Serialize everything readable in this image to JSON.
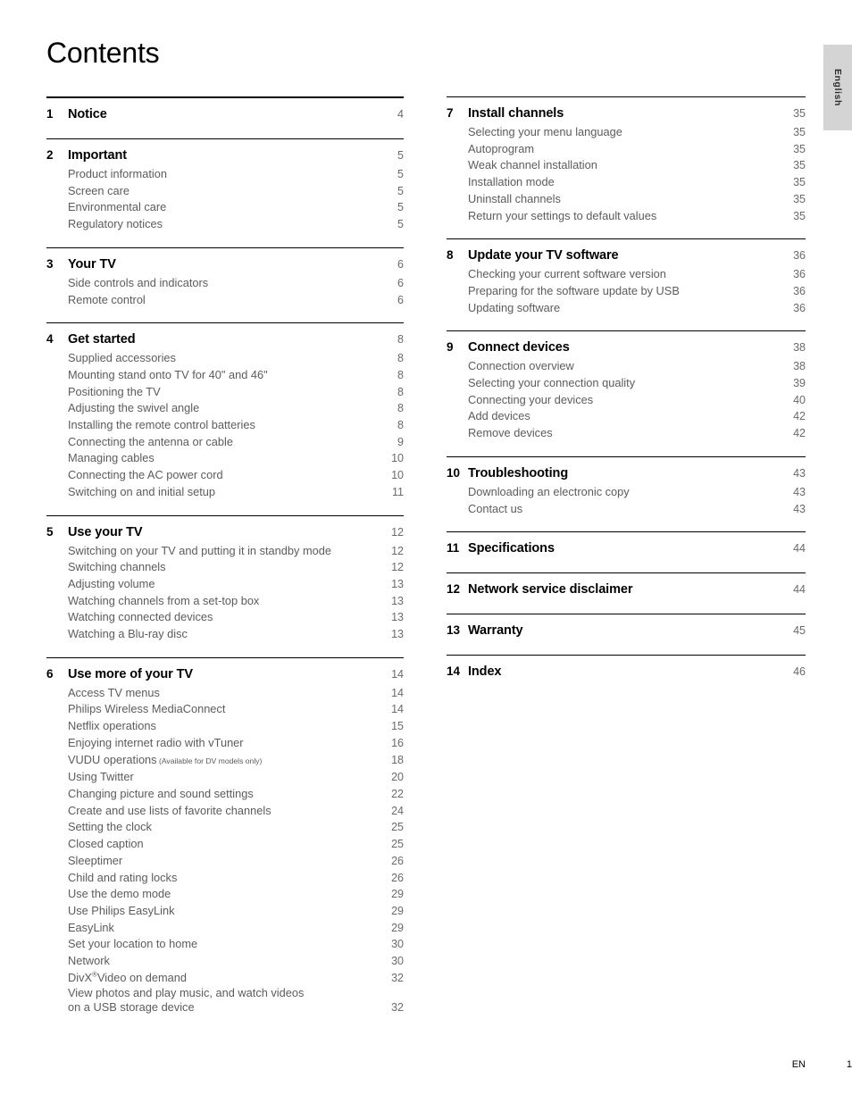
{
  "page_title": "Contents",
  "side_tab": {
    "label": "English"
  },
  "footer": {
    "locale": "EN",
    "page_number": "1"
  },
  "columns": {
    "left": [
      {
        "rule": "thick",
        "number": "1",
        "title": "Notice",
        "page": "4",
        "items": []
      },
      {
        "rule": "thin",
        "number": "2",
        "title": "Important",
        "page": "5",
        "items": [
          {
            "label": "Product information",
            "page": "5"
          },
          {
            "label": "Screen care",
            "page": "5"
          },
          {
            "label": "Environmental care",
            "page": "5"
          },
          {
            "label": "Regulatory notices",
            "page": "5"
          }
        ]
      },
      {
        "rule": "thin",
        "number": "3",
        "title": "Your TV",
        "page": "6",
        "items": [
          {
            "label": "Side controls and indicators",
            "page": "6"
          },
          {
            "label": "Remote control",
            "page": "6"
          }
        ]
      },
      {
        "rule": "thin",
        "number": "4",
        "title": "Get started",
        "page": "8",
        "items": [
          {
            "label": "Supplied accessories",
            "page": "8"
          },
          {
            "label": "Mounting stand onto TV for 40\" and 46\"",
            "page": "8"
          },
          {
            "label": "Positioning the TV",
            "page": "8"
          },
          {
            "label": "Adjusting the swivel angle",
            "page": "8"
          },
          {
            "label": "Installing the remote control batteries",
            "page": "8"
          },
          {
            "label": "Connecting the antenna or cable",
            "page": "9"
          },
          {
            "label": "Managing cables",
            "page": "10"
          },
          {
            "label": "Connecting the AC power cord",
            "page": "10"
          },
          {
            "label": "Switching on and initial setup",
            "page": "11"
          }
        ]
      },
      {
        "rule": "thin",
        "number": "5",
        "title": "Use your TV",
        "page": "12",
        "items": [
          {
            "label": "Switching on your TV and putting it in standby mode",
            "page": "12"
          },
          {
            "label": "Switching channels",
            "page": "12"
          },
          {
            "label": "Adjusting volume",
            "page": "13"
          },
          {
            "label": "Watching channels from a set-top box",
            "page": "13"
          },
          {
            "label": "Watching connected devices",
            "page": "13"
          },
          {
            "label": "Watching a Blu-ray disc",
            "page": "13"
          }
        ]
      },
      {
        "rule": "thin",
        "number": "6",
        "title": "Use more of your TV",
        "page": "14",
        "items": [
          {
            "label": "Access TV menus",
            "page": "14"
          },
          {
            "label": "Philips Wireless MediaConnect",
            "page": "14"
          },
          {
            "label": "Netflix operations",
            "page": "15"
          },
          {
            "label": "Enjoying internet radio with vTuner",
            "page": "16"
          },
          {
            "label": "VUDU operations",
            "note": "(Available for DV models only)",
            "page": "18"
          },
          {
            "label": "Using Twitter",
            "page": "20"
          },
          {
            "label": "Changing picture and sound settings",
            "page": "22"
          },
          {
            "label": "Create and use lists of favorite channels",
            "page": "24"
          },
          {
            "label": "Setting the clock",
            "page": "25"
          },
          {
            "label": "Closed caption",
            "page": "25"
          },
          {
            "label": "Sleeptimer",
            "page": "26"
          },
          {
            "label": "Child and rating locks",
            "page": "26"
          },
          {
            "label": "Use the demo mode",
            "page": "29"
          },
          {
            "label": "Use Philips EasyLink",
            "page": "29"
          },
          {
            "label": "EasyLink",
            "page": "29"
          },
          {
            "label": "Set your location to home",
            "page": "30"
          },
          {
            "label": "Network",
            "page": "30"
          },
          {
            "label": "DivX",
            "sup": "®",
            "label_after_sup": "Video on demand",
            "page": "32"
          },
          {
            "label": "View photos and play music, and watch videos",
            "label_line2": "on a USB storage device",
            "page": "32"
          }
        ]
      }
    ],
    "right": [
      {
        "rule": "thin",
        "number": "7",
        "title": "Install channels",
        "page": "35",
        "items": [
          {
            "label": "Selecting your menu language",
            "page": "35"
          },
          {
            "label": "Autoprogram",
            "page": "35"
          },
          {
            "label": "Weak channel installation",
            "page": "35"
          },
          {
            "label": "Installation mode",
            "page": "35"
          },
          {
            "label": "Uninstall channels",
            "page": "35"
          },
          {
            "label": "Return your settings to default values",
            "page": "35"
          }
        ]
      },
      {
        "rule": "thin",
        "number": "8",
        "title": "Update your TV software",
        "page": "36",
        "items": [
          {
            "label": "Checking your current software version",
            "page": "36"
          },
          {
            "label": "Preparing for the software update by USB",
            "page": "36"
          },
          {
            "label": "Updating software",
            "page": "36"
          }
        ]
      },
      {
        "rule": "thin",
        "number": "9",
        "title": "Connect devices",
        "page": "38",
        "items": [
          {
            "label": "Connection overview",
            "page": "38"
          },
          {
            "label": "Selecting your connection quality",
            "page": "39"
          },
          {
            "label": "Connecting your devices",
            "page": "40"
          },
          {
            "label": "Add devices",
            "page": "42"
          },
          {
            "label": "Remove devices",
            "page": "42"
          }
        ]
      },
      {
        "rule": "thin",
        "number": "10",
        "title": "Troubleshooting",
        "page": "43",
        "items": [
          {
            "label": "Downloading an electronic copy",
            "page": "43"
          },
          {
            "label": "Contact us",
            "page": "43"
          }
        ]
      },
      {
        "rule": "thin",
        "number": "11",
        "title": "Specifications",
        "page": "44",
        "items": []
      },
      {
        "rule": "thin",
        "number": "12",
        "title": "Network service disclaimer",
        "page": "44",
        "items": []
      },
      {
        "rule": "thin",
        "number": "13",
        "title": "Warranty",
        "page": "45",
        "items": []
      },
      {
        "rule": "thin",
        "number": "14",
        "title": "Index",
        "page": "46",
        "items": []
      }
    ]
  }
}
